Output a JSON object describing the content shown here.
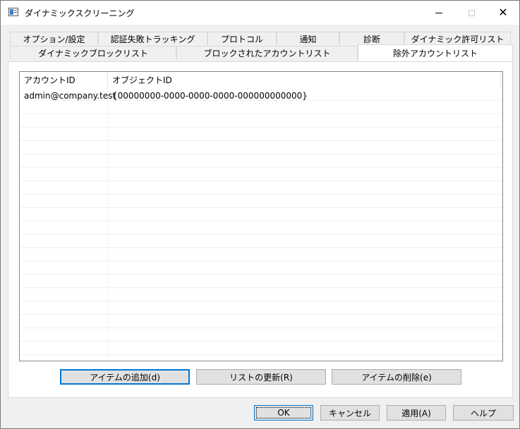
{
  "window": {
    "title": "ダイナミックスクリーニング"
  },
  "tabs_row1": [
    "オプション/設定",
    "認証失敗トラッキング",
    "プロトコル",
    "通知",
    "診断",
    "ダイナミック許可リスト"
  ],
  "tabs_row2": [
    "ダイナミックブロックリスト",
    "ブロックされたアカウントリスト",
    "除外アカウントリスト"
  ],
  "active_tab": "除外アカウントリスト",
  "list": {
    "columns": [
      "アカウントID",
      "オブジェクトID"
    ],
    "rows": [
      {
        "account_id": "admin@company.test",
        "object_id": "{00000000-0000-0000-0000-000000000000}"
      }
    ]
  },
  "panel_buttons": {
    "add": "アイテムの追加(d)",
    "refresh": "リストの更新(R)",
    "delete": "アイテムの削除(e)"
  },
  "dialog_buttons": {
    "ok": "OK",
    "cancel": "キャンセル",
    "apply": "適用(A)",
    "help": "ヘルプ"
  },
  "colors": {
    "focus_border": "#0078d7",
    "window_bg": "#f0f0f0",
    "panel_bg": "#ffffff"
  }
}
